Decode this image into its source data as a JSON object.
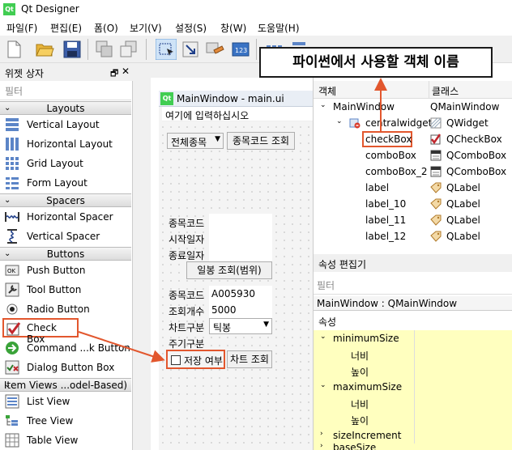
{
  "app": {
    "title": "Qt Designer",
    "logo_text": "Qt"
  },
  "menubar": [
    "파일(F)",
    "편집(E)",
    "폼(O)",
    "보기(V)",
    "설정(S)",
    "창(W)",
    "도움말(H)"
  ],
  "widget_box": {
    "title": "위젯 상자",
    "filter_placeholder": "필터",
    "categories": {
      "layouts": "Layouts",
      "spacers": "Spacers",
      "buttons": "Buttons",
      "item_views": "Item Views ...odel-Based)"
    },
    "items": {
      "vertical_layout": "Vertical Layout",
      "horizontal_layout": "Horizontal Layout",
      "grid_layout": "Grid Layout",
      "form_layout": "Form Layout",
      "horizontal_spacer": "Horizontal Spacer",
      "vertical_spacer": "Vertical Spacer",
      "push_button": "Push Button",
      "tool_button": "Tool Button",
      "radio_button": "Radio Button",
      "check_box": "Check Box",
      "command_button": "Command ...k Button",
      "dialog_button_box": "Dialog Button Box",
      "list_view": "List View",
      "tree_view": "Tree View",
      "table_view": "Table View"
    }
  },
  "form": {
    "title": "MainWindow - main.ui",
    "menu_placeholder": "여기에 입력하십시오",
    "combo_all": "전체종목",
    "btn_code_search": "종목코드 조회",
    "lbl_code": "종목코드",
    "lbl_start": "시작일자",
    "lbl_end": "종료일자",
    "btn_daily": "일봉 조회(범위)",
    "lbl_code2": "종목코드",
    "val_code2": "A005930",
    "lbl_count": "조회개수",
    "val_count": "5000",
    "lbl_chart": "차트구분",
    "combo_chart": "틱봉",
    "lbl_period": "주기구분",
    "chk_save": "저장 여부",
    "btn_chart": "차트 조회"
  },
  "callout": {
    "text": "파이썬에서 사용할 객체 이름"
  },
  "object_inspector": {
    "col_object": "객체",
    "col_class": "클래스",
    "rows": [
      {
        "name": "MainWindow",
        "class": "QMainWindow"
      },
      {
        "name": "centralwidget",
        "class": "QWidget"
      },
      {
        "name": "checkBox",
        "class": "QCheckBox"
      },
      {
        "name": "comboBox",
        "class": "QComboBox"
      },
      {
        "name": "comboBox_2",
        "class": "QComboBox"
      },
      {
        "name": "label",
        "class": "QLabel"
      },
      {
        "name": "label_10",
        "class": "QLabel"
      },
      {
        "name": "label_11",
        "class": "QLabel"
      },
      {
        "name": "label_12",
        "class": "QLabel"
      }
    ]
  },
  "property_editor": {
    "title": "속성 편집기",
    "filter_placeholder": "필터",
    "class_line": "MainWindow : QMainWindow",
    "col_property": "속성",
    "rows": [
      "minimumSize",
      "너비",
      "높이",
      "maximumSize",
      "너비",
      "높이",
      "sizeIncrement",
      "baseSize"
    ]
  },
  "colors": {
    "accent_red": "#e2572e",
    "qt_green": "#41cd52",
    "highlight_yellow": "#ffffbf"
  }
}
